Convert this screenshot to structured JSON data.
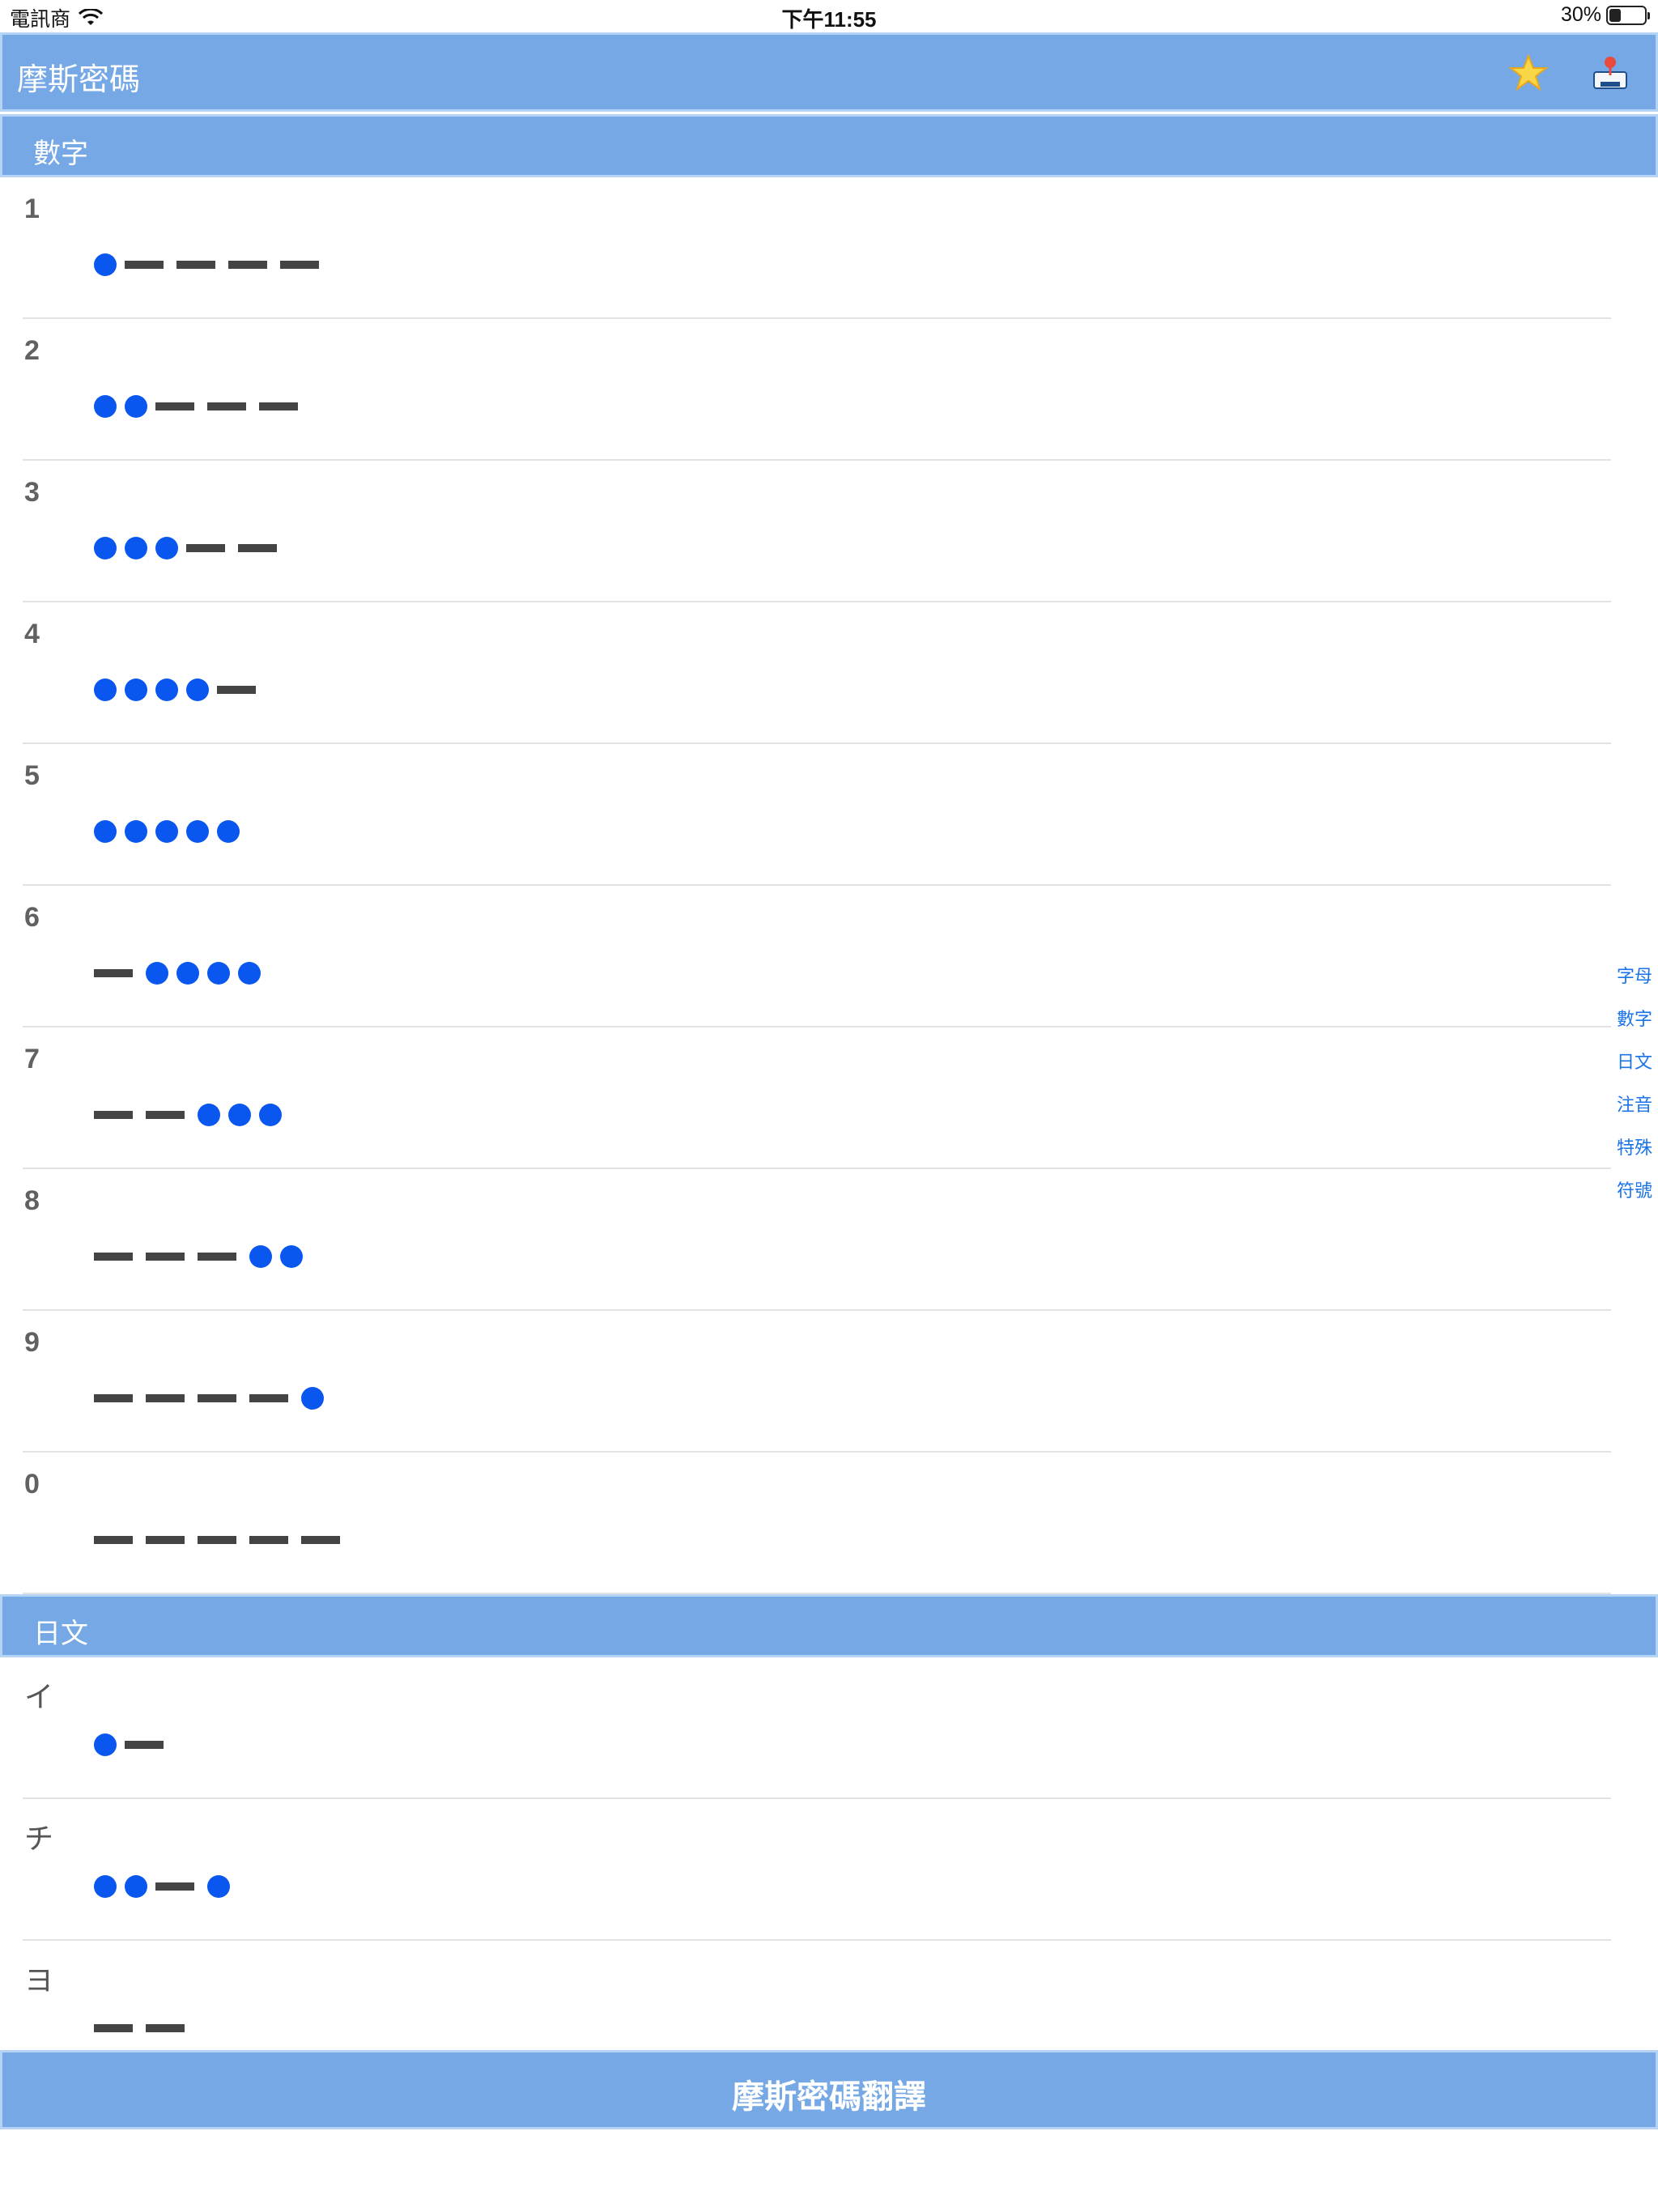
{
  "status_bar": {
    "carrier": "電訊商",
    "time": "下午11:55",
    "battery": "30%",
    "battery_level": 0.3
  },
  "navbar": {
    "title": "摩斯密碼",
    "favorites_icon": "star-icon",
    "share_icon": "inbox-icon"
  },
  "sections": [
    {
      "title": "數字",
      "rows": [
        {
          "label": "1",
          "code": ".----"
        },
        {
          "label": "2",
          "code": "..---"
        },
        {
          "label": "3",
          "code": "...--"
        },
        {
          "label": "4",
          "code": "....-"
        },
        {
          "label": "5",
          "code": "....."
        },
        {
          "label": "6",
          "code": "-...."
        },
        {
          "label": "7",
          "code": "--..."
        },
        {
          "label": "8",
          "code": "---.."
        },
        {
          "label": "9",
          "code": "----."
        },
        {
          "label": "0",
          "code": "-----"
        }
      ]
    },
    {
      "title": "日文",
      "rows": [
        {
          "label": "イ",
          "code": ".-"
        },
        {
          "label": "チ",
          "code": "..-."
        },
        {
          "label": "ヨ",
          "code": "--"
        }
      ]
    }
  ],
  "index": [
    "字母",
    "數字",
    "日文",
    "注音",
    "特殊",
    "符號"
  ],
  "bottom_button": "摩斯密碼翻譯",
  "colors": {
    "bar": "#75a8e5",
    "dot": "#0a57f0",
    "dash": "#444444",
    "index_text": "#1a73e8"
  }
}
